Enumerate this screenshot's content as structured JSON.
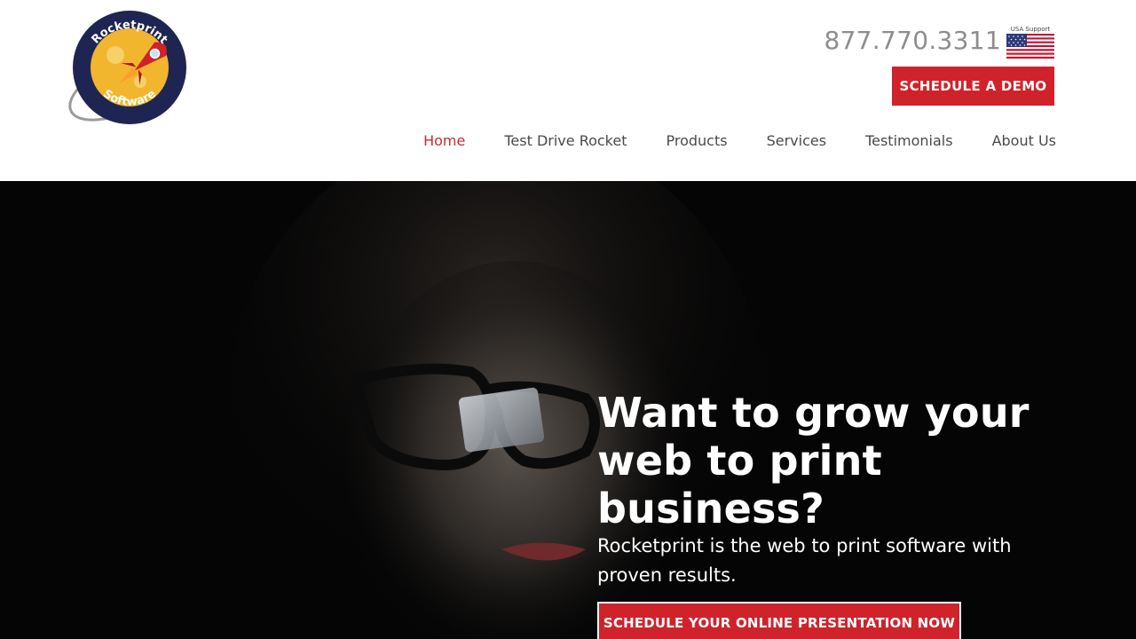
{
  "header": {
    "logo_text_top": "Rocketprint",
    "logo_text_bottom": "Software",
    "phone": "877.770.3311",
    "usa_support": "USA Support",
    "demo_button": "SCHEDULE A DEMO"
  },
  "nav": {
    "items": [
      {
        "label": "Home",
        "active": true
      },
      {
        "label": "Test Drive Rocket",
        "active": false
      },
      {
        "label": "Products",
        "active": false
      },
      {
        "label": "Services",
        "active": false
      },
      {
        "label": "Testimonials",
        "active": false
      },
      {
        "label": "About Us",
        "active": false
      }
    ]
  },
  "hero": {
    "title": "Want to grow your web to print business?",
    "subtitle": "Rocketprint is the web to print software with proven results.",
    "cta": "SCHEDULE YOUR ONLINE PRESENTATION NOW"
  },
  "colors": {
    "brand_red": "#d0222a",
    "nav_active": "#c62a2f",
    "hero_bg": "#050505"
  },
  "icons": [
    "rocket-logo-icon",
    "usa-flag-icon"
  ]
}
